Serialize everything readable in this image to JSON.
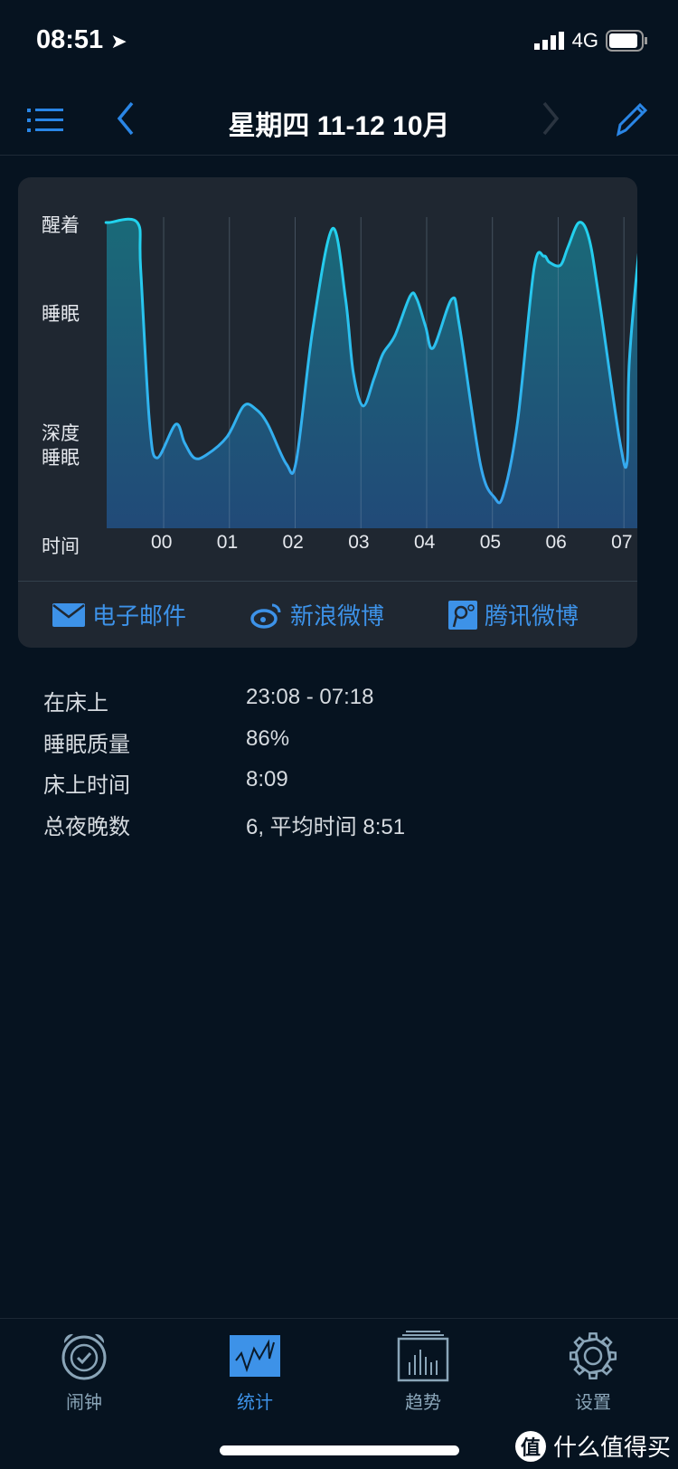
{
  "status_bar": {
    "time": "08:51",
    "network": "4G",
    "icons": [
      "location-arrow-icon",
      "signal-icon",
      "battery-icon"
    ]
  },
  "header": {
    "title": "星期四 11-12 10月",
    "icons": [
      "menu-list-icon",
      "chevron-left-icon",
      "chevron-right-icon",
      "pencil-icon"
    ]
  },
  "chart_data": {
    "type": "area",
    "y_labels": {
      "awake": "醒着",
      "sleep": "睡眠",
      "deep_sleep": "深度\n睡眠"
    },
    "x_axis_label": "时间",
    "x_ticks": [
      "00",
      "01",
      "02",
      "03",
      "04",
      "05",
      "06",
      "07"
    ],
    "x_range": [
      "23:08",
      "07:18"
    ],
    "y_scale": "sleep depth level, 1 = 醒着, 0 = deepest",
    "ylim": [
      0,
      1
    ],
    "grid": "vertical",
    "series": [
      {
        "points": [
          [
            "23:08",
            1.0
          ],
          [
            "23:10",
            1.0
          ],
          [
            "23:36",
            1.0
          ],
          [
            "23:39",
            0.85
          ],
          [
            "23:47",
            0.35
          ],
          [
            "23:54",
            0.23
          ],
          [
            "00:11",
            0.34
          ],
          [
            "00:19",
            0.28
          ],
          [
            "00:28",
            0.23
          ],
          [
            "00:39",
            0.24
          ],
          [
            "00:58",
            0.3
          ],
          [
            "01:13",
            0.4
          ],
          [
            "01:24",
            0.39
          ],
          [
            "01:35",
            0.34
          ],
          [
            "01:52",
            0.21
          ],
          [
            "02:01",
            0.22
          ],
          [
            "02:16",
            0.65
          ],
          [
            "02:34",
            0.98
          ],
          [
            "02:46",
            0.75
          ],
          [
            "02:53",
            0.51
          ],
          [
            "03:02",
            0.4
          ],
          [
            "03:12",
            0.49
          ],
          [
            "03:20",
            0.57
          ],
          [
            "03:31",
            0.63
          ],
          [
            "03:45",
            0.76
          ],
          [
            "03:51",
            0.75
          ],
          [
            "03:59",
            0.66
          ],
          [
            "04:06",
            0.59
          ],
          [
            "04:23",
            0.75
          ],
          [
            "04:30",
            0.66
          ],
          [
            "04:49",
            0.21
          ],
          [
            "05:02",
            0.1
          ],
          [
            "05:10",
            0.11
          ],
          [
            "05:23",
            0.35
          ],
          [
            "05:38",
            0.85
          ],
          [
            "05:47",
            0.89
          ],
          [
            "05:52",
            0.87
          ],
          [
            "06:02",
            0.86
          ],
          [
            "06:09",
            0.92
          ],
          [
            "06:19",
            1.0
          ],
          [
            "06:28",
            0.95
          ],
          [
            "06:37",
            0.76
          ],
          [
            "06:56",
            0.29
          ],
          [
            "07:03",
            0.22
          ],
          [
            "07:05",
            0.55
          ],
          [
            "07:16",
            0.99
          ],
          [
            "07:18",
            1.0
          ]
        ]
      }
    ],
    "colors": {
      "line_top": "#22d3ee",
      "line_bottom": "#3aa0f0",
      "fill_top": "#1a6a78",
      "fill_bottom": "#214a78"
    }
  },
  "share": [
    {
      "label": "电子邮件",
      "icon": "envelope-icon"
    },
    {
      "label": "新浪微博",
      "icon": "weibo-icon"
    },
    {
      "label": "腾讯微博",
      "icon": "tencent-weibo-icon"
    }
  ],
  "stats": [
    {
      "label": "在床上",
      "value": "23:08 - 07:18"
    },
    {
      "label": "睡眠质量",
      "value": "86%"
    },
    {
      "label": "床上时间",
      "value": "8:09"
    },
    {
      "label": "总夜晚数",
      "value": "6, 平均时间 8:51"
    }
  ],
  "tabs": [
    {
      "label": "闹钟",
      "icon": "alarm-clock-icon",
      "active": false
    },
    {
      "label": "统计",
      "icon": "statistics-chart-icon",
      "active": true
    },
    {
      "label": "趋势",
      "icon": "trends-bar-icon",
      "active": false
    },
    {
      "label": "设置",
      "icon": "gear-icon",
      "active": false
    }
  ],
  "watermark": "什么值得买",
  "accent": "#3d92e8"
}
